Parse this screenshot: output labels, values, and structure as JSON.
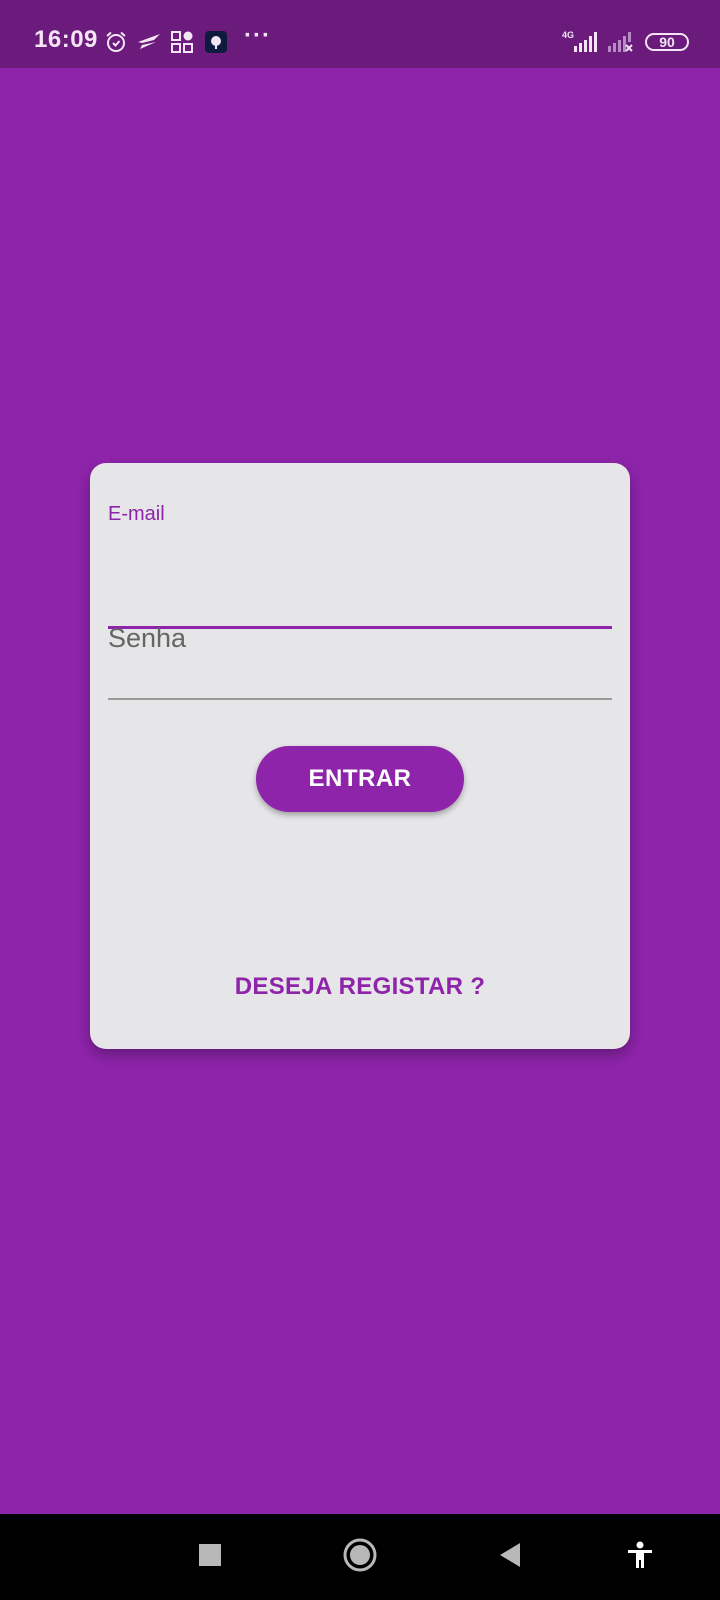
{
  "status_bar": {
    "time": "16:09",
    "network": "4G",
    "battery": "90",
    "more": "···",
    "icons": [
      "alarm-icon",
      "airplane-icon",
      "apps-icon",
      "app-notification-icon",
      "signal-icon",
      "signal-no-service-icon"
    ]
  },
  "login": {
    "email_label": "E-mail",
    "password_placeholder": "Senha",
    "submit_label": "ENTRAR",
    "register_label": "DESEJA REGISTAR ?"
  },
  "nav_bar": {
    "icons": [
      "recents-icon",
      "home-icon",
      "back-icon",
      "accessibility-icon"
    ]
  },
  "colors": {
    "primary": "#8e24aa",
    "status_bar": "#6a1b7c",
    "card": "#e6e5e7"
  }
}
